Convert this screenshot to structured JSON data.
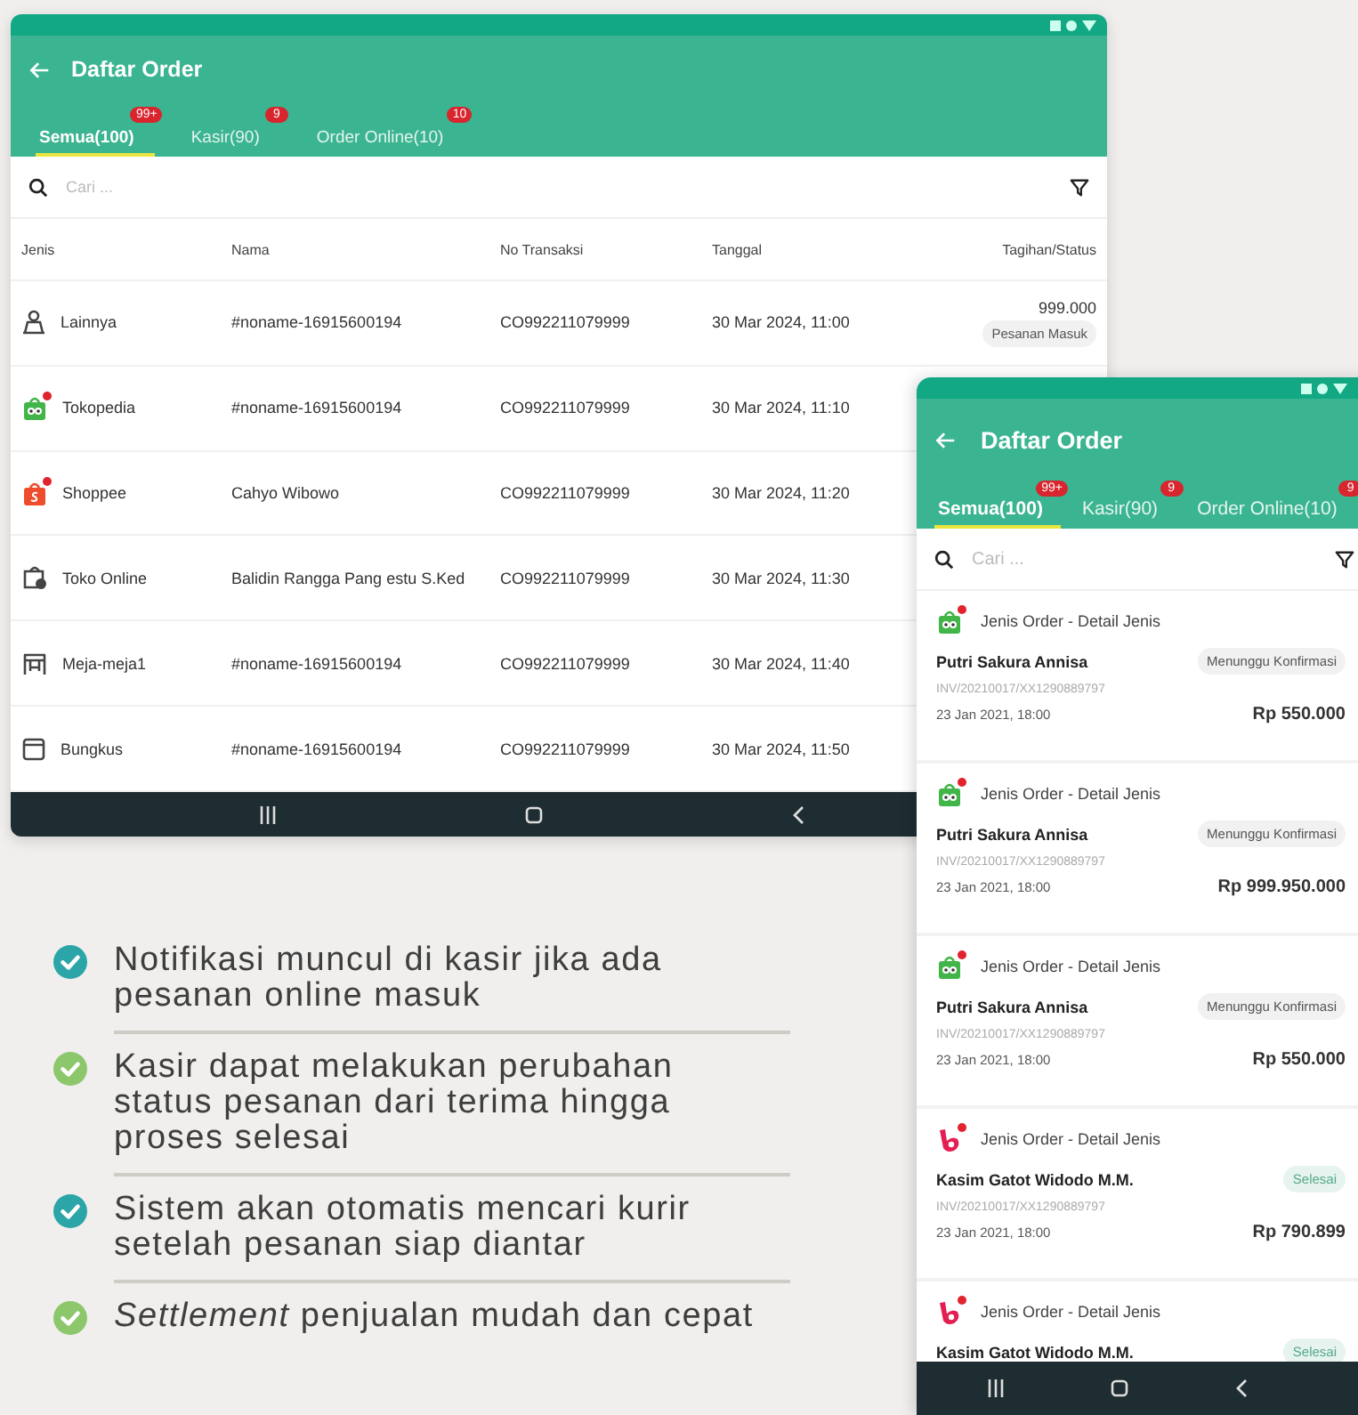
{
  "tablet": {
    "title": "Daftar Order",
    "tabs": [
      {
        "label": "Semua(100)",
        "badge": "99+",
        "selected": true
      },
      {
        "label": "Kasir(90)",
        "badge": "9",
        "selected": false
      },
      {
        "label": "Order Online(10)",
        "badge": "10",
        "selected": false
      }
    ],
    "search": {
      "placeholder": "Cari ..."
    },
    "columns": [
      "Jenis",
      "Nama",
      "No Transaksi",
      "Tanggal",
      "Tagihan/Status"
    ],
    "rows": [
      {
        "kind": "lainnya",
        "jenis": "Lainnya",
        "new": false,
        "nama": "#noname-16915600194",
        "no": "CO992211079999",
        "tanggal": "30 Mar 2024, 11:00",
        "amount": "999.000",
        "status": "Pesanan Masuk"
      },
      {
        "kind": "tokopedia",
        "jenis": "Tokopedia",
        "new": true,
        "nama": "#noname-16915600194",
        "no": "CO992211079999",
        "tanggal": "30 Mar 2024, 11:10"
      },
      {
        "kind": "shopee",
        "jenis": "Shoppee",
        "new": true,
        "nama": "Cahyo Wibowo",
        "no": "CO992211079999",
        "tanggal": "30 Mar 2024, 11:20"
      },
      {
        "kind": "toko",
        "jenis": "Toko Online",
        "new": false,
        "nama": "Balidin Rangga Pang estu S.Ked",
        "no": "CO992211079999",
        "tanggal": "30 Mar 2024, 11:30"
      },
      {
        "kind": "meja",
        "jenis": "Meja-meja1",
        "new": false,
        "nama": "#noname-16915600194",
        "no": "CO992211079999",
        "tanggal": "30 Mar 2024, 11:40"
      },
      {
        "kind": "bungkus",
        "jenis": "Bungkus",
        "new": false,
        "nama": "#noname-16915600194",
        "no": "CO992211079999",
        "tanggal": "30 Mar 2024, 11:50"
      }
    ]
  },
  "phone": {
    "title": "Daftar Order",
    "tabs": [
      {
        "label": "Semua(100)",
        "badge": "99+",
        "selected": true
      },
      {
        "label": "Kasir(90)",
        "badge": "9",
        "selected": false
      },
      {
        "label": "Order Online(10)",
        "badge": "9",
        "selected": false
      }
    ],
    "search": {
      "placeholder": "Cari ..."
    },
    "cards": [
      {
        "kind": "tokopedia",
        "new": true,
        "type": "Jenis Order - Detail Jenis",
        "name": "Putri Sakura Annisa",
        "status": "Menunggu Konfirmasi",
        "done": false,
        "invoice": "INV/20210017/XX1290889797",
        "date": "23 Jan 2021, 18:00",
        "amount": "Rp 550.000"
      },
      {
        "kind": "tokopedia",
        "new": true,
        "type": "Jenis Order - Detail Jenis",
        "name": "Putri Sakura Annisa",
        "status": "Menunggu Konfirmasi",
        "done": false,
        "invoice": "INV/20210017/XX1290889797",
        "date": "23 Jan 2021, 18:00",
        "amount": "Rp 999.950.000"
      },
      {
        "kind": "tokopedia",
        "new": true,
        "type": "Jenis Order - Detail Jenis",
        "name": "Putri Sakura Annisa",
        "status": "Menunggu Konfirmasi",
        "done": false,
        "invoice": "INV/20210017/XX1290889797",
        "date": "23 Jan 2021, 18:00",
        "amount": "Rp 550.000"
      },
      {
        "kind": "bukalapak",
        "new": true,
        "type": "Jenis Order - Detail Jenis",
        "name": "Kasim Gatot Widodo M.M.",
        "status": "Selesai",
        "done": true,
        "invoice": "INV/20210017/XX1290889797",
        "date": "23 Jan 2021, 18:00",
        "amount": "Rp 790.899"
      },
      {
        "kind": "bukalapak",
        "new": true,
        "type": "Jenis Order - Detail Jenis",
        "name": "Kasim Gatot Widodo M.M.",
        "status": "Selesai",
        "done": true
      }
    ]
  },
  "features": [
    {
      "text": "Notifikasi muncul di kasir jika ada pesanan online masuk",
      "color": "#2ba5a8"
    },
    {
      "text": "Kasir dapat melakukan perubahan status pesanan dari terima hingga proses selesai",
      "color": "#8cc76c"
    },
    {
      "text": "Sistem akan otomatis mencari kurir setelah pesanan siap diantar",
      "color": "#2ba5a8"
    },
    {
      "text": "*Settlement* penjualan mudah dan cepat",
      "color": "#8cc76c"
    }
  ]
}
